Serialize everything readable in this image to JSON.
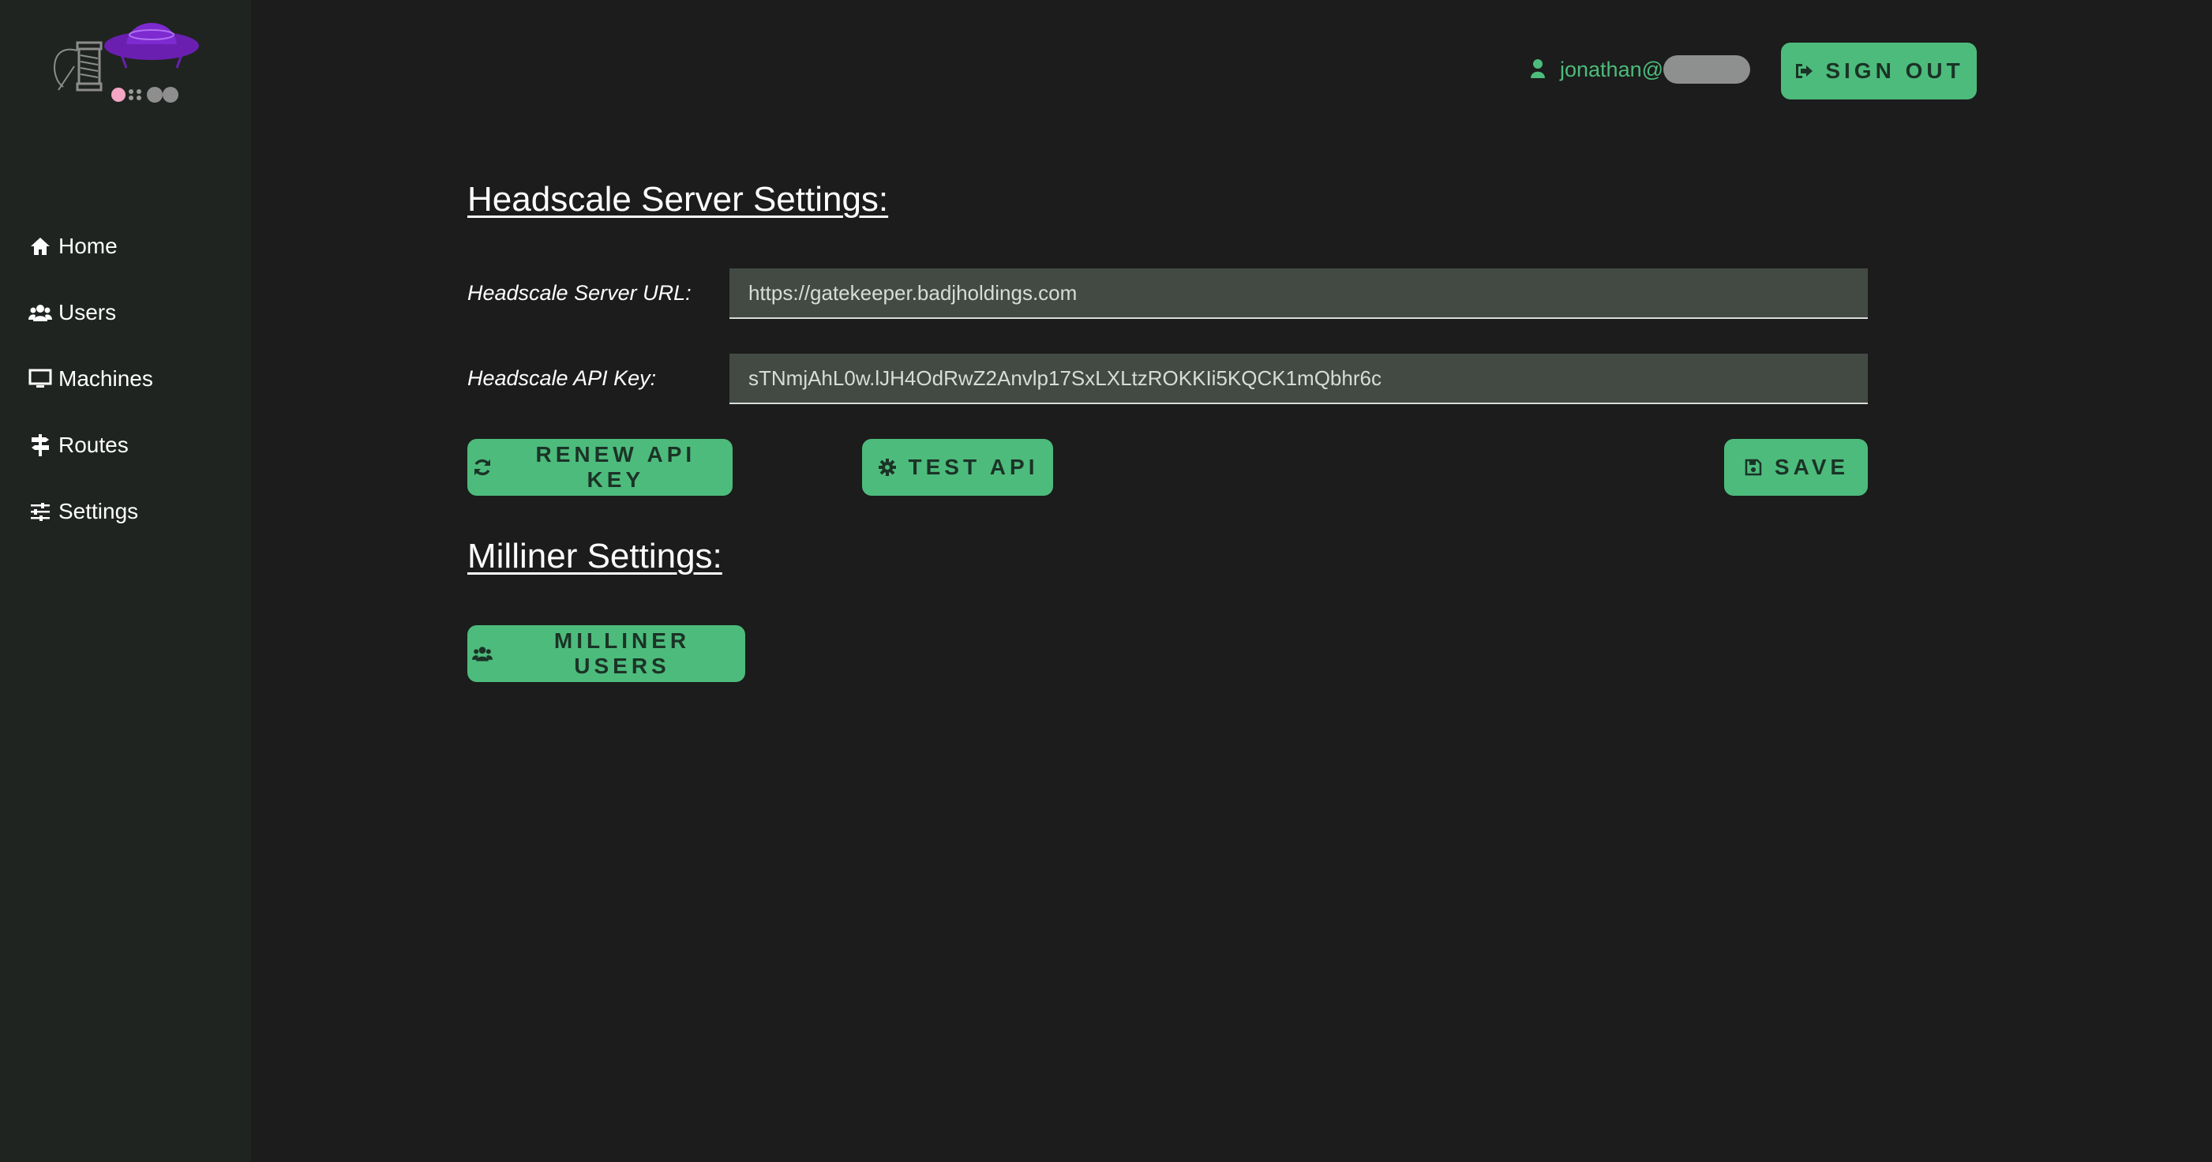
{
  "header": {
    "user_name": "jonathan@",
    "sign_out_label": "SIGN OUT"
  },
  "sidebar": {
    "items": [
      {
        "label": "Home",
        "icon": "home-icon"
      },
      {
        "label": "Users",
        "icon": "users-icon"
      },
      {
        "label": "Machines",
        "icon": "desktop-icon"
      },
      {
        "label": "Routes",
        "icon": "signpost-icon"
      },
      {
        "label": "Settings",
        "icon": "sliders-icon"
      }
    ]
  },
  "headscale": {
    "title": "Headscale Server Settings:",
    "url_label": "Headscale Server URL:",
    "url_value": "https://gatekeeper.badjholdings.com",
    "key_label": "Headscale API Key:",
    "key_value": "sTNmjAhL0w.lJH4OdRwZ2Anvlp17SxLXLtzROKKIi5KQCK1mQbhr6c",
    "renew_label": "RENEW API KEY",
    "test_label": "TEST API",
    "save_label": "SAVE"
  },
  "milliner": {
    "title": "Milliner Settings:",
    "users_label": "MILLINER USERS"
  },
  "colors": {
    "accent": "#4dbb7c",
    "background": "#1b1c1b",
    "sidebar": "#1f2420",
    "input": "#434a44",
    "logo_purple": "#6a1fb0"
  }
}
